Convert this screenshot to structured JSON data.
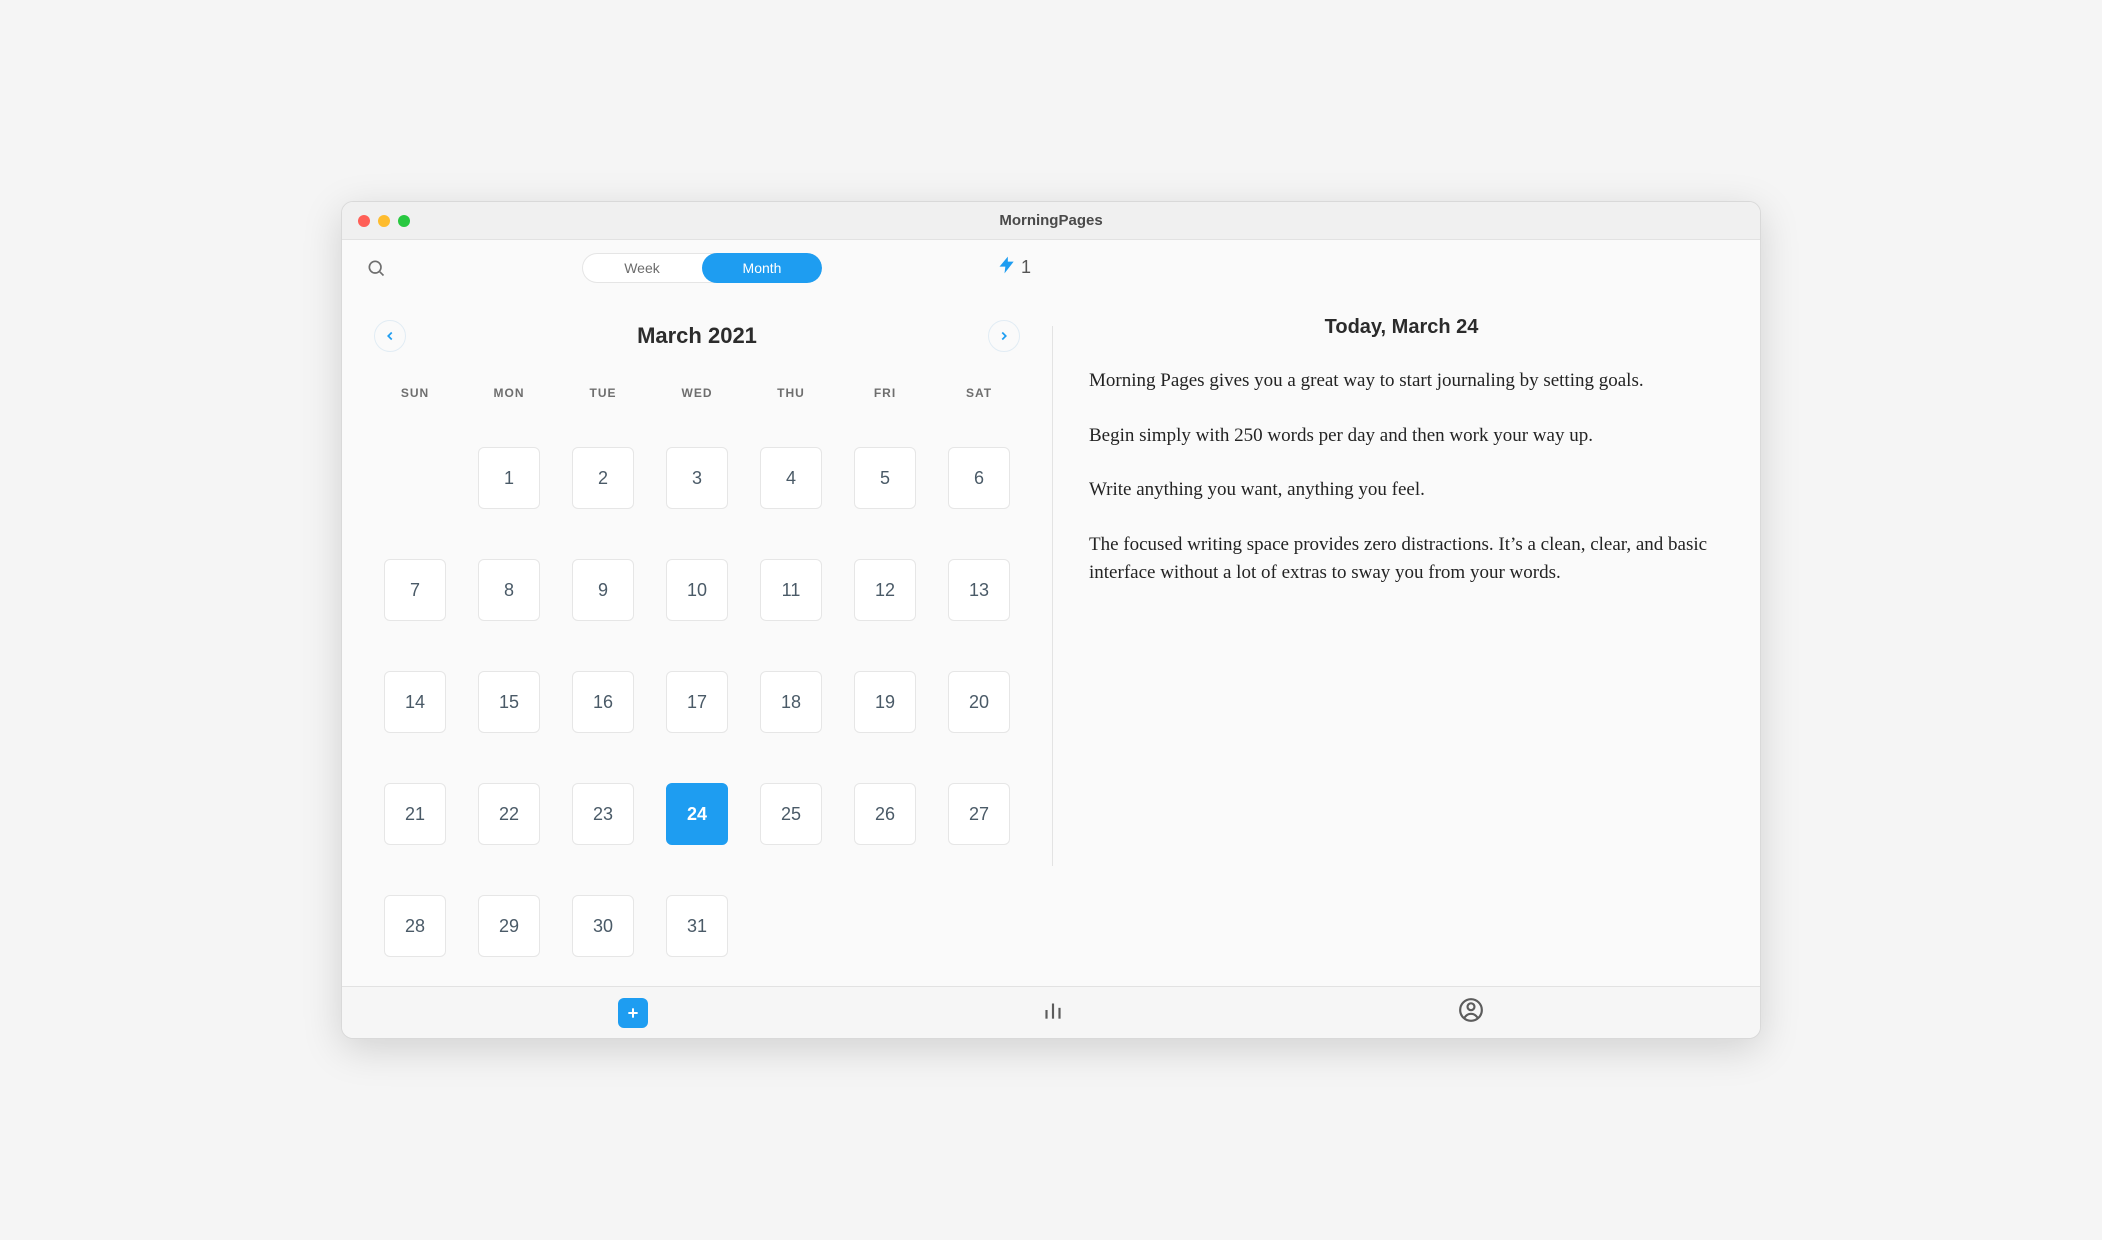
{
  "window": {
    "title": "MorningPages"
  },
  "toolbar": {
    "segments": {
      "week": "Week",
      "month": "Month",
      "active": "month"
    },
    "streak_count": "1"
  },
  "calendar": {
    "title": "March 2021",
    "weekdays": [
      "SUN",
      "MON",
      "TUE",
      "WED",
      "THU",
      "FRI",
      "SAT"
    ],
    "first_day_offset": 1,
    "days_in_month": 31,
    "selected_day": 24
  },
  "entry": {
    "title": "Today, March 24",
    "paragraphs": [
      "Morning Pages gives you a great way to start journaling by setting goals.",
      "Begin simply with 250 words per day and then work your way up.",
      "Write anything you want, anything you feel.",
      "The focused writing space provides zero distractions. It’s a clean, clear, and basic interface without a lot of extras to sway you from your words."
    ]
  },
  "colors": {
    "accent": "#1e9df1"
  }
}
